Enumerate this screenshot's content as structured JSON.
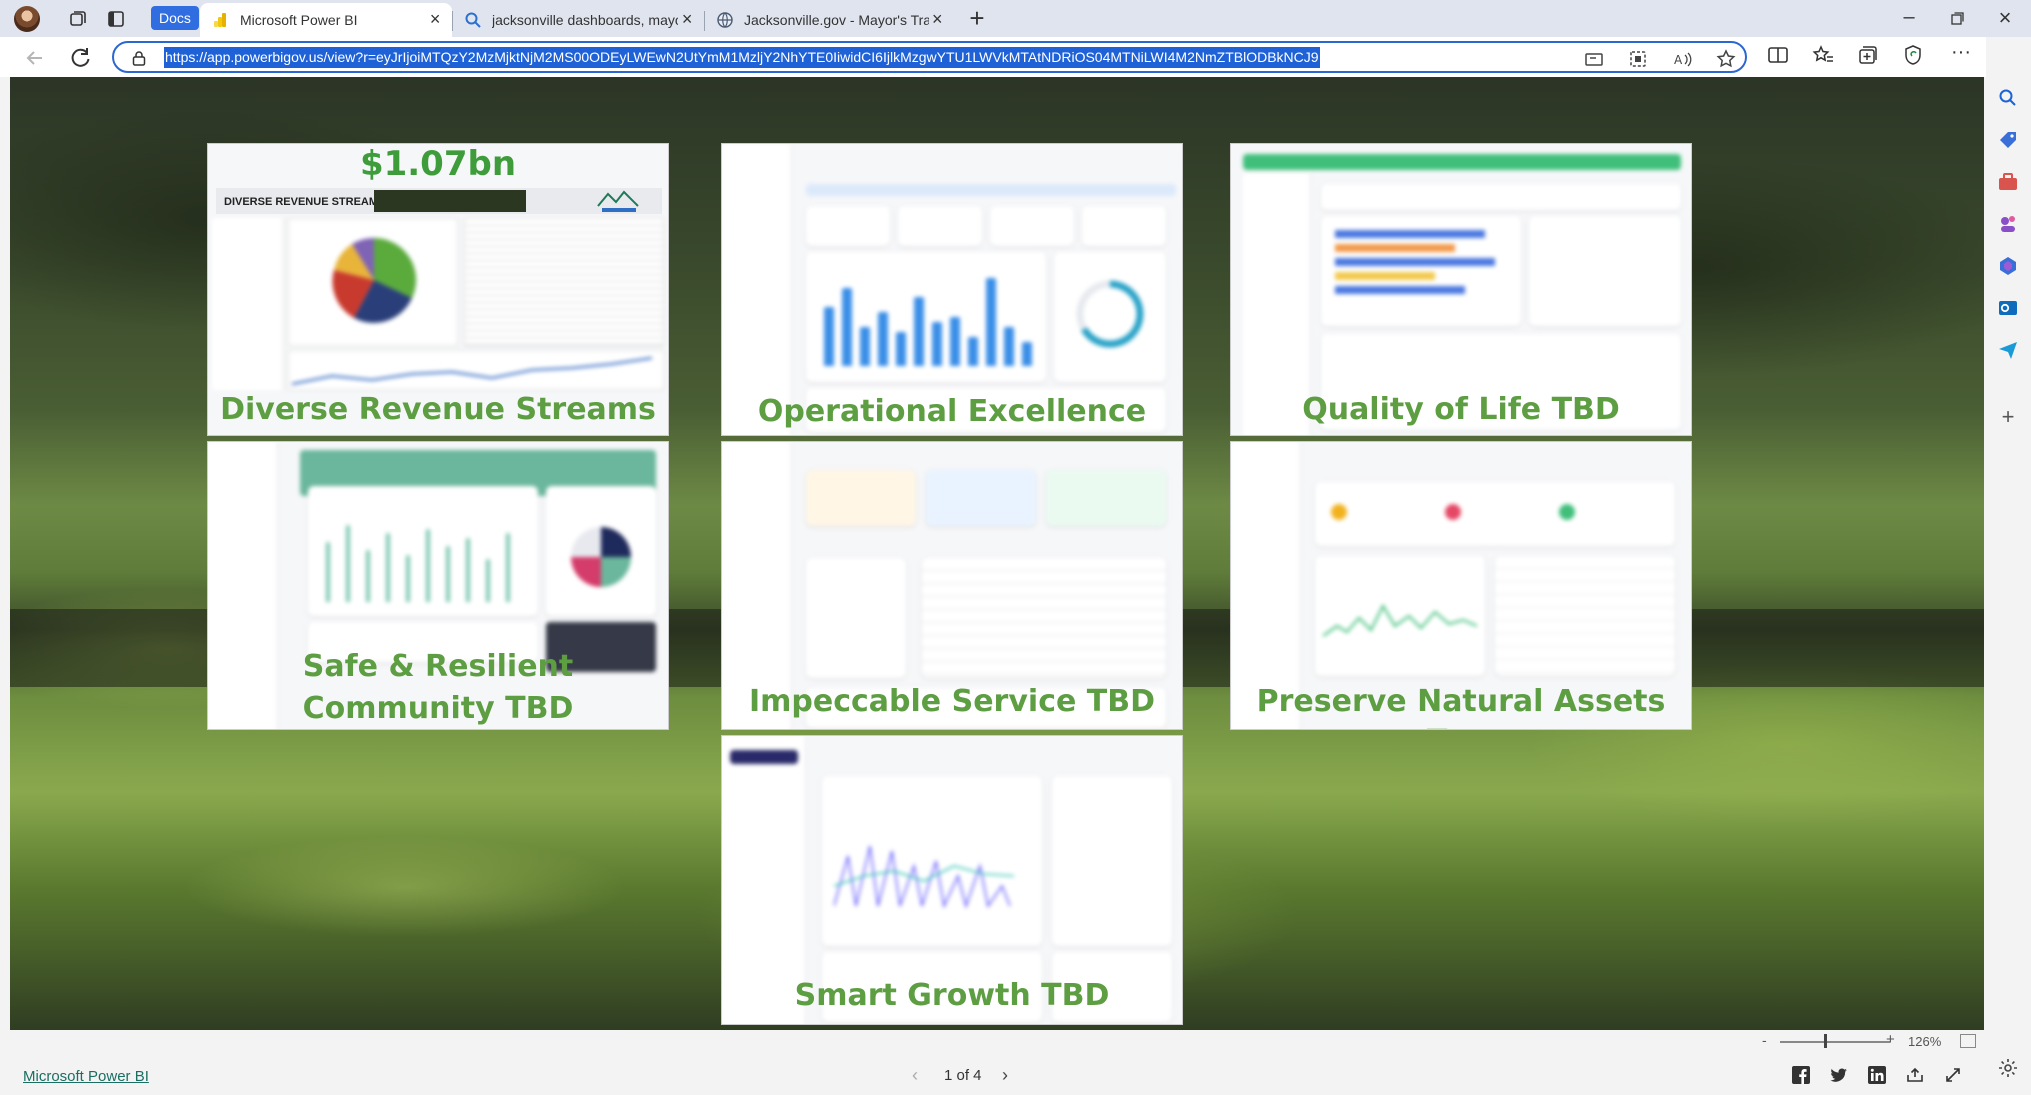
{
  "browser": {
    "docs_badge": "Docs",
    "tabs": [
      {
        "label": "Microsoft Power BI",
        "icon": "power-bi-icon",
        "active": true
      },
      {
        "label": "jacksonville dashboards, mayor -",
        "icon": "search-icon",
        "active": false
      },
      {
        "label": "Jacksonville.gov - Mayor's Transp",
        "icon": "globe-icon",
        "active": false
      }
    ],
    "new_tab": "+",
    "url": "https://app.powerbigov.us/view?r=eyJrIjoiMTQzY2MzMjktNjM2MS00ODEyLWEwN2UtYmM1MzljY2NhYTE0IiwidCI6IjlkMzgwYTU1LWVkMTAtNDRiOS04MTNiLWI4M2NmZTBlODBkNCJ9",
    "zoom": "126%"
  },
  "tiles": [
    {
      "title": "Diverse Revenue Streams",
      "amount": "$1.07bn",
      "heading": "DIVERSE REVENUE STREAMS"
    },
    {
      "title": "Operational Excellence TBD"
    },
    {
      "title": "Quality of Life TBD"
    },
    {
      "title": "Safe & Resilient Community TBD"
    },
    {
      "title": "Impeccable Service TBD"
    },
    {
      "title": "Preserve Natural Assets TBD"
    },
    {
      "title": "Smart Growth TBD"
    }
  ],
  "footer": {
    "brand_link": "Microsoft Power BI",
    "page_indicator": "1 of 4",
    "prev": "‹",
    "next": "›"
  },
  "colors": {
    "accent": "#2f6de1",
    "tile_title": "#5e9e42",
    "amount": "#3e9d3a"
  }
}
